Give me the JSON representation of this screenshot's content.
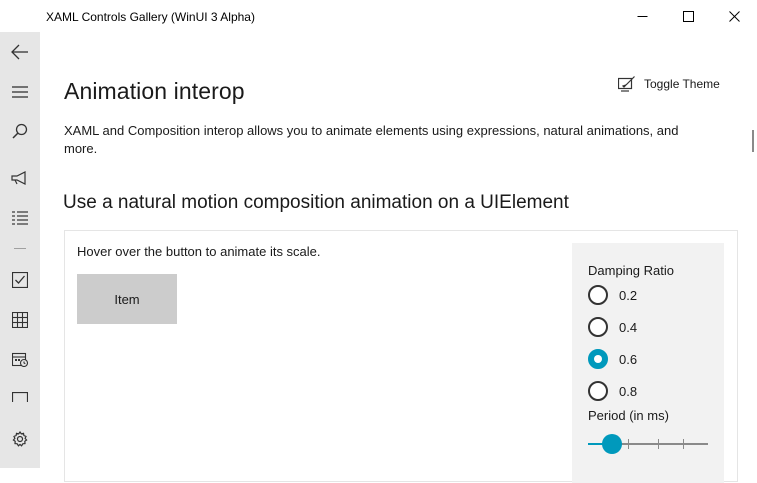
{
  "window": {
    "title": "XAML Controls Gallery (WinUI 3 Alpha)",
    "controls": [
      "minimize-icon",
      "maximize-icon",
      "close-icon"
    ]
  },
  "nav": {
    "icons": [
      "back-arrow-icon",
      "hamburger-menu-icon",
      "search-icon",
      "megaphone-icon",
      "list-icon",
      "checkbox-icon",
      "grid-icon",
      "calendar-icon",
      "bracket-icon",
      "settings-gear-icon"
    ]
  },
  "page": {
    "title": "Animation interop",
    "toggle_theme": "Toggle Theme",
    "description": "XAML and Composition interop allows you to animate elements using expressions, natural animations, and more.",
    "section_title": "Use a natural motion composition animation on a UIElement"
  },
  "example": {
    "hint": "Hover over the button to animate its scale.",
    "item_label": "Item",
    "damping_label": "Damping Ratio",
    "damping_options": [
      "0.2",
      "0.4",
      "0.6",
      "0.8"
    ],
    "damping_selected": "0.6",
    "period_label": "Period (in ms)",
    "period_slider_fraction": 0.2
  },
  "colors": {
    "accent": "#0099bc",
    "nav_background": "#e6e6e6",
    "button_background": "#cccccc",
    "options_panel": "#f2f2f2"
  }
}
